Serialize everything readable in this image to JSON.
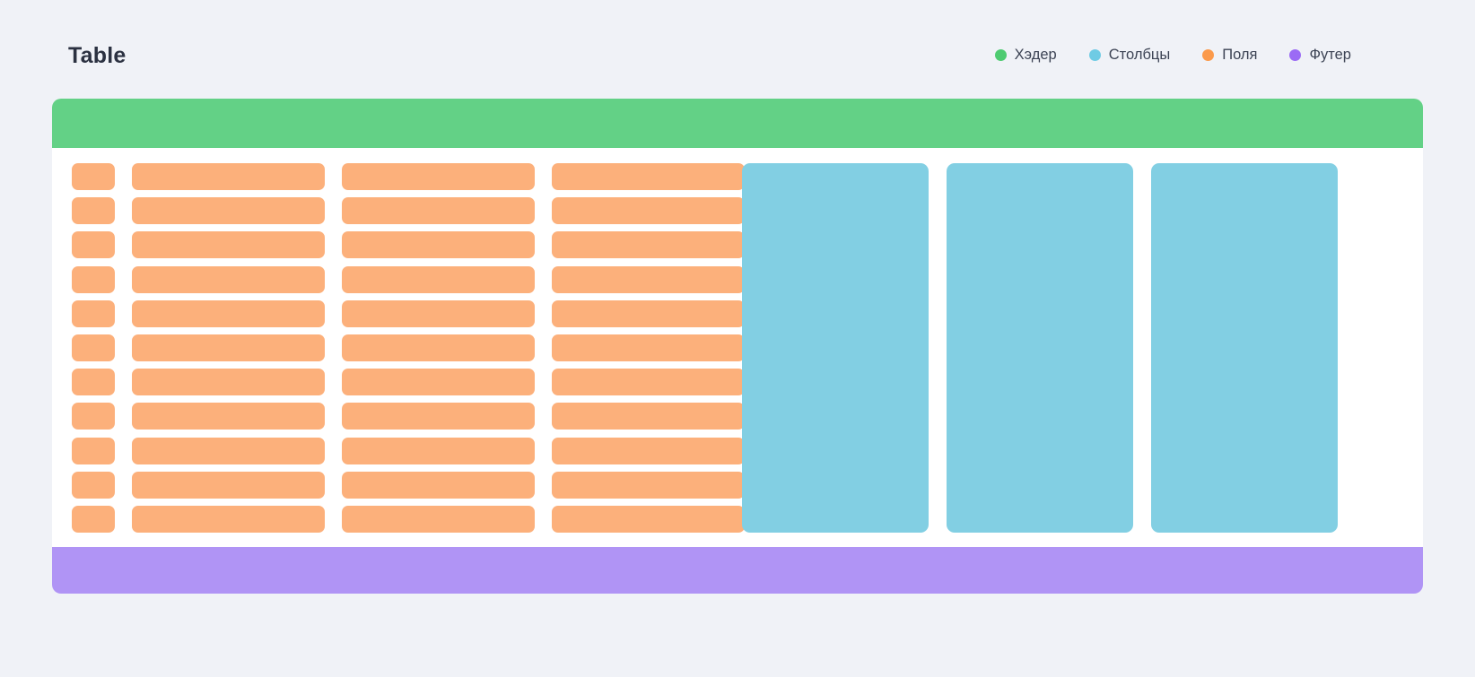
{
  "page": {
    "title": "Table",
    "background_color": "#F0F2F7"
  },
  "legend": {
    "items": [
      {
        "label": "Хэдер",
        "color": "#4ECB71",
        "icon": "legend-dot-icon"
      },
      {
        "label": "Столбцы",
        "color": "#6FCBE4",
        "icon": "legend-dot-icon"
      },
      {
        "label": "Поля",
        "color": "#FB9A4B",
        "icon": "legend-dot-icon"
      },
      {
        "label": "Футер",
        "color": "#9B6BF5",
        "icon": "legend-dot-icon"
      }
    ]
  },
  "card": {
    "background_color": "#FFFFFF",
    "header": {
      "name": "Хэдер",
      "color": "#63D186"
    },
    "footer": {
      "name": "Футер",
      "color": "#B094F5"
    },
    "fields": {
      "name": "Поля",
      "color": "#FCB07B",
      "row_count": 11,
      "cells_per_row": 4,
      "cell_widths": [
        "narrow",
        "wide",
        "wide",
        "wide"
      ]
    },
    "columns": {
      "name": "Столбцы",
      "color": "#82CFE3",
      "count": 3
    }
  }
}
